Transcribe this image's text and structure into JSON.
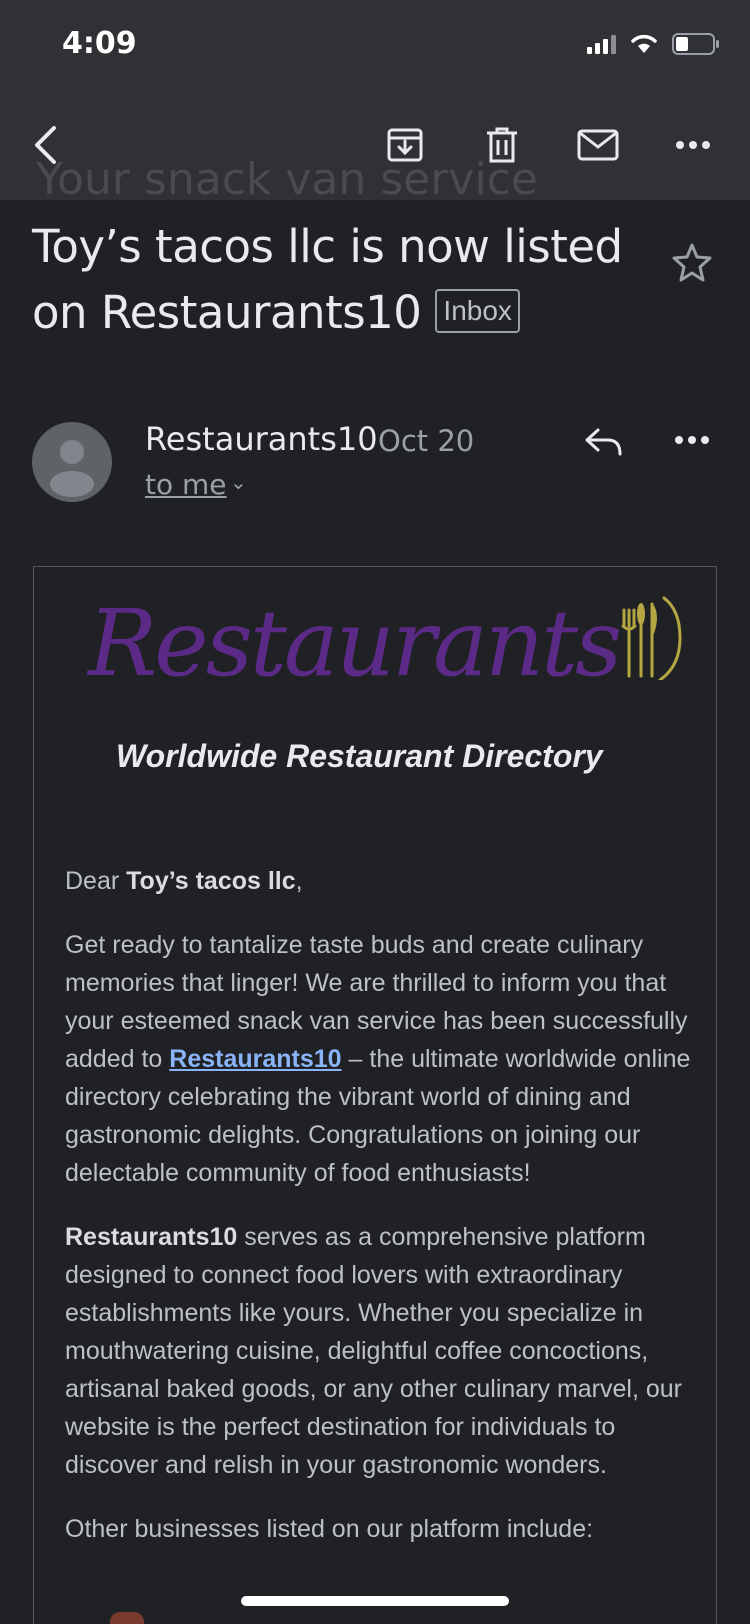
{
  "status_bar": {
    "time": "4:09"
  },
  "toolbar": {
    "back": "back-arrow-icon",
    "archive": "archive-icon",
    "delete": "trash-icon",
    "mark_unread": "mail-icon",
    "more": "more-horiz-icon"
  },
  "ghost_subject": "Your snack van service",
  "email": {
    "subject": "Toy’s tacos llc is now listed on Restaurants10",
    "label": "Inbox",
    "sender": "Restaurants10",
    "date": "Oct 20",
    "recipient": "to me"
  },
  "body": {
    "logo_text": "Restaurants",
    "tagline": "Worldwide Restaurant Directory",
    "greeting_prefix": "Dear ",
    "greeting_name": "Toy’s tacos llc",
    "greeting_suffix": ",",
    "p1_before_link": "Get ready to tantalize taste buds and create culinary memories that linger! We are thrilled to inform you that your esteemed snack van service has been successfully added to ",
    "p1_link": "Restaurants10",
    "p1_after_link": " – the ultimate worldwide online directory celebrating the vibrant world of dining and gastronomic delights. Congratulations on joining our delectable community of food enthusiasts!",
    "p2_bold": "Restaurants10",
    "p2_rest": " serves as a comprehensive platform designed to connect food lovers with extraordinary establishments like yours. Whether you specialize in mouthwatering cuisine, delightful coffee concoctions, artisanal baked goods, or any other culinary marvel, our website is the perfect destination for individuals to discover and relish in your gastronomic wonders.",
    "p3": "Other businesses listed on our platform include:"
  },
  "colors": {
    "background": "#202124",
    "toolbar": "#303134",
    "logo_purple": "#5b2a86",
    "logo_gold": "#b5a642",
    "link": "#8ab4f8"
  }
}
